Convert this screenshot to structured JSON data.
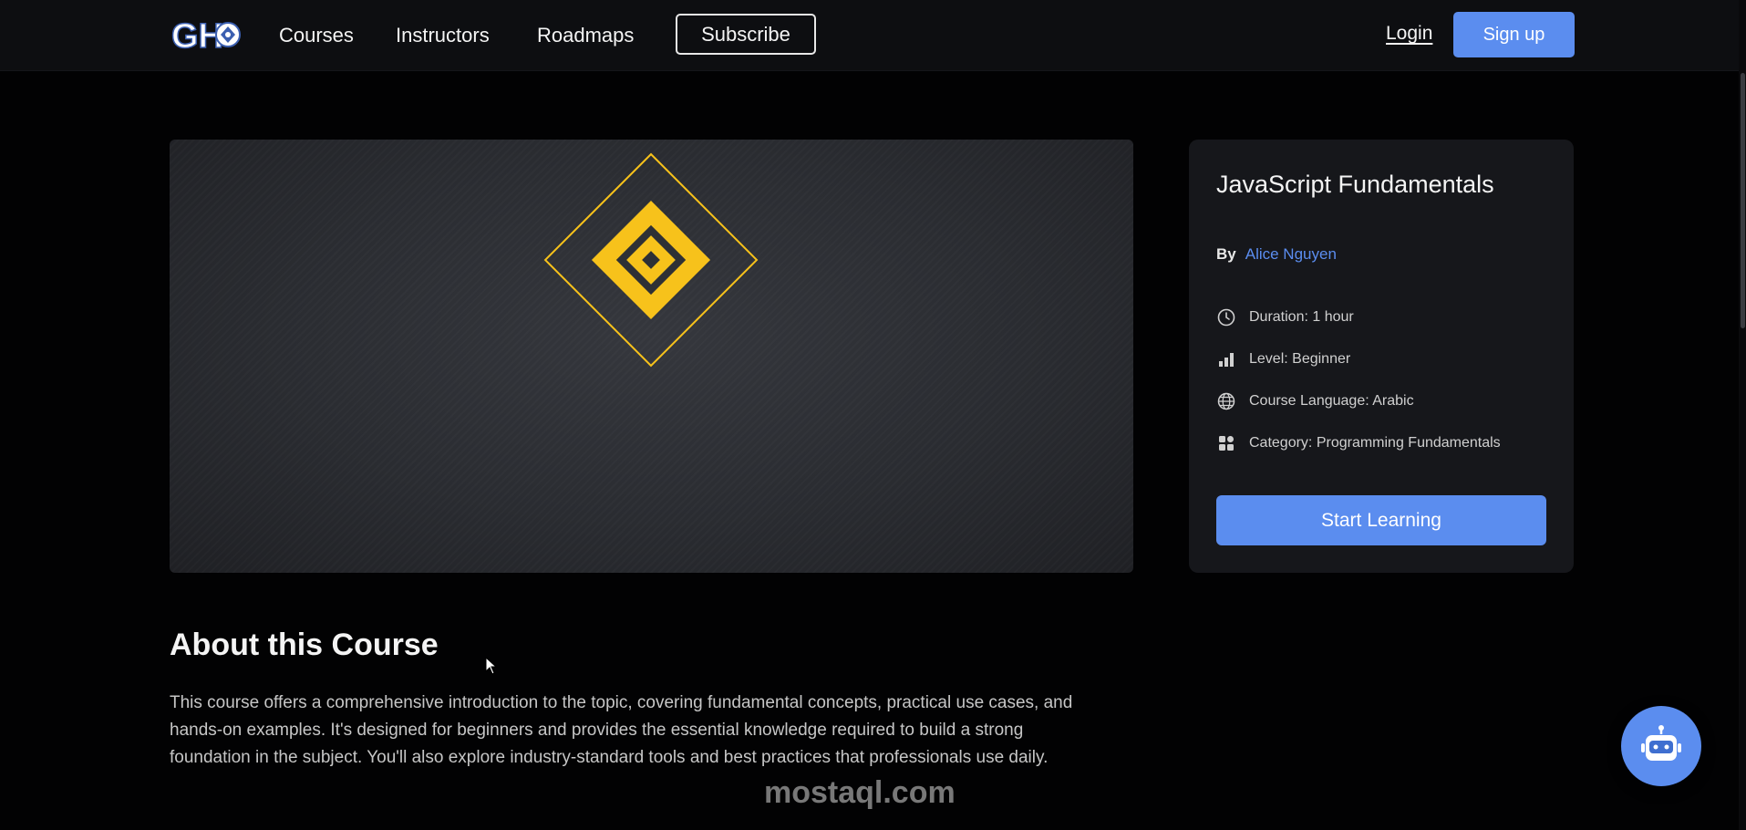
{
  "navbar": {
    "logo_text": "GH",
    "links": {
      "courses": "Courses",
      "instructors": "Instructors",
      "roadmaps": "Roadmaps"
    },
    "subscribe_label": "Subscribe",
    "login_label": "Login",
    "signup_label": "Sign up"
  },
  "course": {
    "title": "JavaScript Fundamentals",
    "author_prefix": "By",
    "author_name": "Alice Nguyen",
    "duration": "Duration: 1 hour",
    "level": "Level: Beginner",
    "language": "Course Language: Arabic",
    "category": "Category: Programming Fundamentals",
    "start_label": "Start Learning"
  },
  "about": {
    "title": "About this Course",
    "description": "This course offers a comprehensive introduction to the topic, covering fundamental concepts, practical use cases, and hands-on examples. It's designed for beginners and provides the essential knowledge required to build a strong foundation in the subject. You'll also explore industry-standard tools and best practices that professionals use daily."
  },
  "watermark": "mostaql.com",
  "icons": {
    "duration": "clock-icon",
    "level": "bar-chart-icon",
    "language": "globe-icon",
    "category": "grid-icon",
    "assistant": "robot-icon"
  },
  "colors": {
    "accent": "#5b8def",
    "emblem": "#f7c21b",
    "background": "#020203",
    "card": "#16171b"
  }
}
